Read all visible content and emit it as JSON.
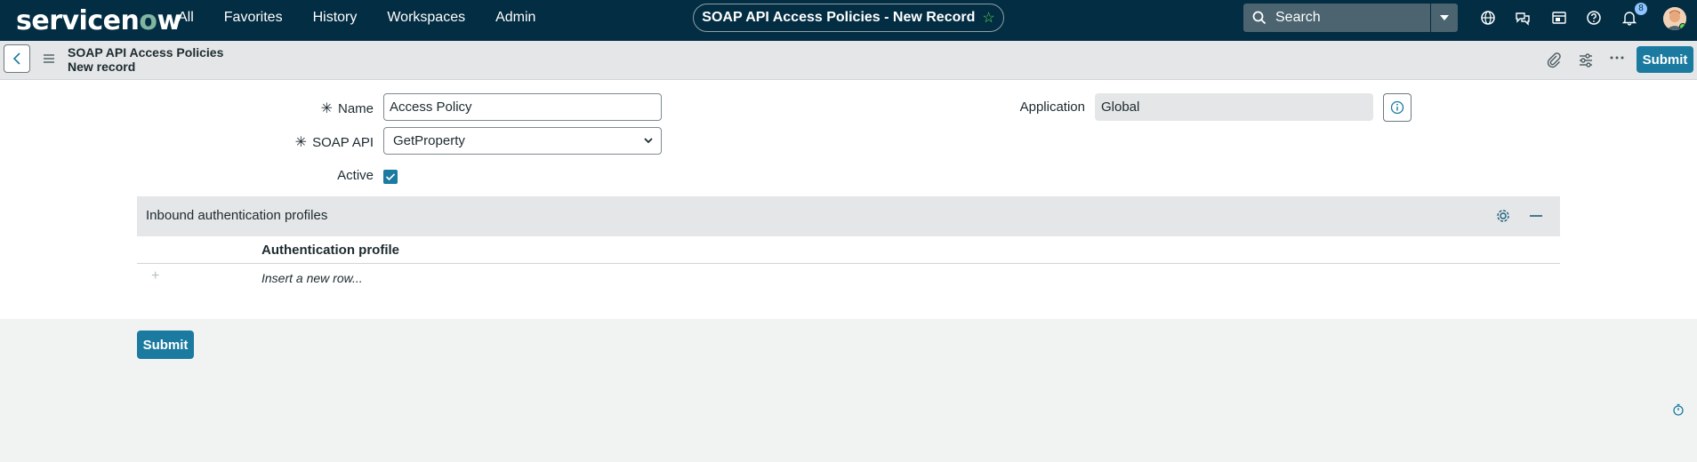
{
  "topnav": {
    "logo_main": "servicen",
    "logo_accent": "o",
    "logo_end": "w",
    "items": [
      "All",
      "Favorites",
      "History",
      "Workspaces",
      "Admin"
    ],
    "record_title": "SOAP API Access Policies - New Record",
    "search_placeholder": "Search",
    "notification_count": "8"
  },
  "subheader": {
    "title_line1": "SOAP API Access Policies",
    "title_line2": "New record",
    "submit_label": "Submit"
  },
  "form": {
    "name_label": "Name",
    "name_value": "Access Policy",
    "soap_api_label": "SOAP API",
    "soap_api_value": "GetProperty",
    "active_label": "Active",
    "active_checked": true,
    "application_label": "Application",
    "application_value": "Global"
  },
  "related": {
    "title": "Inbound authentication profiles",
    "column_header": "Authentication profile",
    "insert_row_text": "Insert a new row...",
    "add_symbol": "+"
  },
  "footer": {
    "submit_label": "Submit"
  },
  "colors": {
    "nav_bg": "#032d42",
    "primary": "#1a7aa0",
    "star": "#62d84e"
  }
}
